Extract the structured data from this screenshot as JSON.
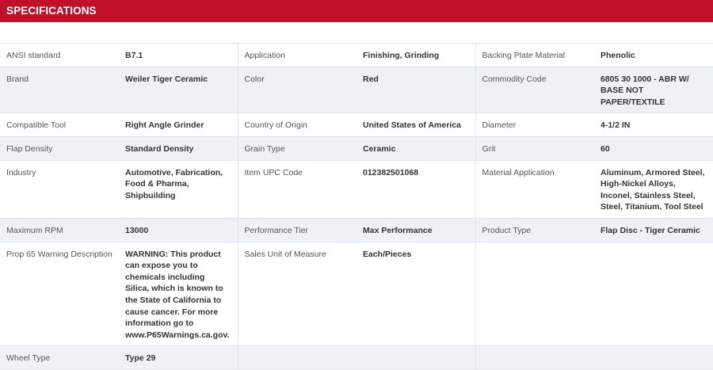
{
  "header": {
    "title": "SPECIFICATIONS"
  },
  "specs": [
    [
      {
        "label": "ANSI standard",
        "value": "B7.1"
      },
      {
        "label": "Application",
        "value": "Finishing, Grinding"
      },
      {
        "label": "Backing Plate Material",
        "value": "Phenolic"
      }
    ],
    [
      {
        "label": "Brand",
        "value": "Weiler Tiger Ceramic"
      },
      {
        "label": "Color",
        "value": "Red"
      },
      {
        "label": "Commodity Code",
        "value": "6805 30 1000 - ABR W/ BASE NOT PAPER/TEXTILE"
      }
    ],
    [
      {
        "label": "Compatible Tool",
        "value": "Right Angle Grinder"
      },
      {
        "label": "Country of Origin",
        "value": "United States of America"
      },
      {
        "label": "Diameter",
        "value": "4-1/2 IN"
      }
    ],
    [
      {
        "label": "Flap Density",
        "value": "Standard Density"
      },
      {
        "label": "Grain Type",
        "value": "Ceramic"
      },
      {
        "label": "Grit",
        "value": "60"
      }
    ],
    [
      {
        "label": "Industry",
        "value": "Automotive, Fabrication, Food & Pharma, Shipbuilding"
      },
      {
        "label": "Item UPC Code",
        "value": "012382501068"
      },
      {
        "label": "Material Application",
        "value": "Aluminum, Armored Steel, High-Nickel Alloys, Inconel, Stainless Steel, Steel, Titanium, Tool Steel"
      }
    ],
    [
      {
        "label": "Maximum RPM",
        "value": "13000"
      },
      {
        "label": "Performance Tier",
        "value": "Max Performance"
      },
      {
        "label": "Product Type",
        "value": "Flap Disc - Tiger Ceramic"
      }
    ],
    [
      {
        "label": "Prop 65 Warning Description",
        "value": "WARNING: This product can expose you to chemicals including Silica, which is known to the State of California to cause cancer. For more information go to www.P65Warnings.ca.gov."
      },
      {
        "label": "Sales Unit of Measure",
        "value": "Each/Pieces"
      },
      {
        "label": "",
        "value": ""
      }
    ],
    [
      {
        "label": "Wheel Type",
        "value": "Type 29"
      },
      {
        "label": "",
        "value": ""
      },
      {
        "label": "",
        "value": ""
      }
    ]
  ]
}
